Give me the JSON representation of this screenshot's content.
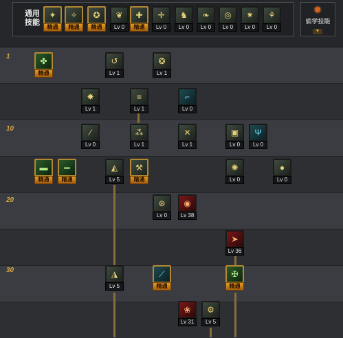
{
  "header": {
    "common_label": "通用\n技能",
    "steal_label": "偷学技能",
    "steal_arrow": "▼"
  },
  "level_markers": [
    "1",
    "10",
    "20",
    "30"
  ],
  "common_skills": [
    {
      "icon": "run-icon",
      "glyph": "✦",
      "level": "精通",
      "mastered": true
    },
    {
      "icon": "dash-icon",
      "glyph": "✧",
      "level": "精通",
      "mastered": true
    },
    {
      "icon": "jump-icon",
      "glyph": "✪",
      "level": "精通",
      "mastered": true
    },
    {
      "icon": "wings-icon",
      "glyph": "❦",
      "level": "Lv 0",
      "mastered": false
    },
    {
      "icon": "crosshair-icon",
      "glyph": "✚",
      "level": "精通",
      "mastered": true
    },
    {
      "icon": "target-icon",
      "glyph": "✛",
      "level": "Lv 0",
      "mastered": false
    },
    {
      "icon": "rider-icon",
      "glyph": "♞",
      "level": "Lv 0",
      "mastered": false
    },
    {
      "icon": "kick-icon",
      "glyph": "❧",
      "level": "Lv 0",
      "mastered": false
    },
    {
      "icon": "bullseye-icon",
      "glyph": "◎",
      "level": "Lv 0",
      "mastered": false
    },
    {
      "icon": "burst-icon",
      "glyph": "✷",
      "level": "Lv 0",
      "mastered": false
    },
    {
      "icon": "figure-icon",
      "glyph": "⚘",
      "level": "Lv 0",
      "mastered": false
    }
  ],
  "tree_skills": [
    {
      "id": "s-r1-1",
      "icon": "clover-icon",
      "glyph": "✤",
      "level": "精通",
      "mastered": true,
      "style": "green"
    },
    {
      "id": "s-r1-2",
      "icon": "swirl-arrow-icon",
      "glyph": "↺",
      "level": "Lv 1",
      "mastered": false,
      "style": ""
    },
    {
      "id": "s-r1-3",
      "icon": "flame-fist-icon",
      "glyph": "❂",
      "level": "Lv 1",
      "mastered": false,
      "style": ""
    },
    {
      "id": "s-r2-1",
      "icon": "explosion-icon",
      "glyph": "✸",
      "level": "Lv 1",
      "mastered": false,
      "style": ""
    },
    {
      "id": "s-r2-2",
      "icon": "rapid-fire-icon",
      "glyph": "≡",
      "level": "Lv 1",
      "mastered": false,
      "style": ""
    },
    {
      "id": "s-r2-3",
      "icon": "gun-icon",
      "glyph": "⌐",
      "level": "Lv 0",
      "mastered": false,
      "style": "teal"
    },
    {
      "id": "s-r3-1",
      "icon": "slash-icon",
      "glyph": "⁄",
      "level": "Lv 0",
      "mastered": false,
      "style": ""
    },
    {
      "id": "s-r3-2",
      "icon": "dual-blast-icon",
      "glyph": "⁂",
      "level": "Lv 1",
      "mastered": false,
      "style": ""
    },
    {
      "id": "s-r3-3",
      "icon": "crossfire-icon",
      "glyph": "✕",
      "level": "Lv 1",
      "mastered": false,
      "style": ""
    },
    {
      "id": "s-r3-4",
      "icon": "ammo-box-icon",
      "glyph": "▣",
      "level": "Lv 0",
      "mastered": false,
      "style": ""
    },
    {
      "id": "s-r3-5",
      "icon": "antenna-icon",
      "glyph": "Ψ",
      "level": "Lv 0",
      "mastered": false,
      "style": "teal"
    },
    {
      "id": "s-r4-1",
      "icon": "rifle-icon",
      "glyph": "▬",
      "level": "精通",
      "mastered": true,
      "style": "green"
    },
    {
      "id": "s-r4-2",
      "icon": "shotgun-icon",
      "glyph": "═",
      "level": "精通",
      "mastered": true,
      "style": "green"
    },
    {
      "id": "s-r4-3",
      "icon": "cannon-icon",
      "glyph": "◭",
      "level": "Lv 5",
      "mastered": false,
      "style": ""
    },
    {
      "id": "s-r4-4",
      "icon": "wrench-icon",
      "glyph": "⚒",
      "level": "精通",
      "mastered": true,
      "style": ""
    },
    {
      "id": "s-r4-5",
      "icon": "spark-figure-icon",
      "glyph": "✺",
      "level": "Lv 0",
      "mastered": false,
      "style": ""
    },
    {
      "id": "s-r4-6",
      "icon": "grenade-icon",
      "glyph": "●",
      "level": "Lv 0",
      "mastered": false,
      "style": ""
    },
    {
      "id": "s-r5-1",
      "icon": "mine-icon",
      "glyph": "⊛",
      "level": "Lv 0",
      "mastered": false,
      "style": ""
    },
    {
      "id": "s-r5-2",
      "icon": "eye-icon",
      "glyph": "◉",
      "level": "Lv 38",
      "mastered": false,
      "style": "red"
    },
    {
      "id": "s-r6-1",
      "icon": "arrow-strike-icon",
      "glyph": "➤",
      "level": "Lv 36",
      "mastered": false,
      "style": "red"
    },
    {
      "id": "s-r7-1",
      "icon": "heavy-cannon-icon",
      "glyph": "◮",
      "level": "Lv 5",
      "mastered": false,
      "style": ""
    },
    {
      "id": "s-r7-2",
      "icon": "lance-icon",
      "glyph": "⟋",
      "level": "精通",
      "mastered": true,
      "style": "teal"
    },
    {
      "id": "s-r7-3",
      "icon": "turret-icon",
      "glyph": "✠",
      "level": "精通",
      "mastered": true,
      "style": "green"
    },
    {
      "id": "s-r8-1",
      "icon": "blaze-icon",
      "glyph": "❀",
      "level": "Lv 31",
      "mastered": false,
      "style": "red"
    },
    {
      "id": "s-r8-2",
      "icon": "gatling-icon",
      "glyph": "⚙",
      "level": "Lv 5",
      "mastered": false,
      "style": ""
    }
  ]
}
